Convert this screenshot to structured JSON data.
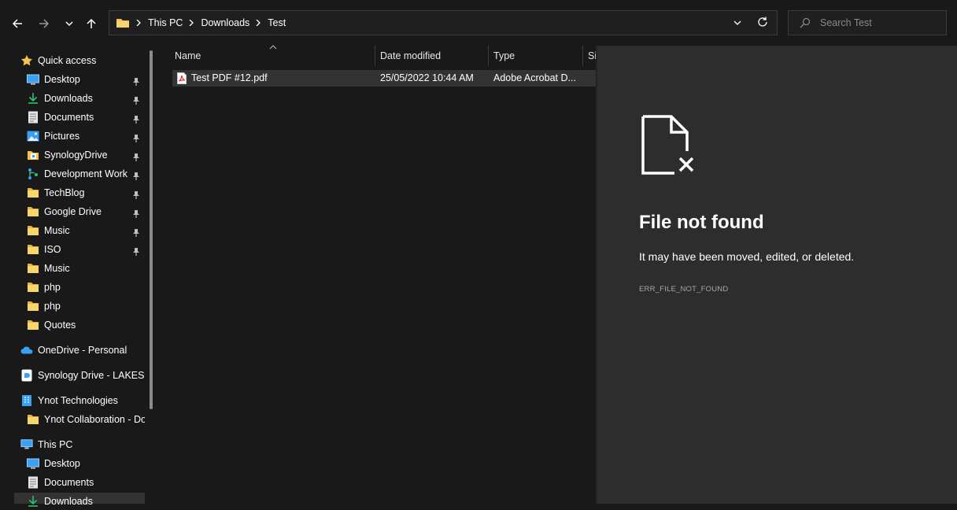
{
  "toolbar": {
    "breadcrumbs": [
      "This PC",
      "Downloads",
      "Test"
    ],
    "search_placeholder": "Search Test"
  },
  "sidebar": {
    "quick_access": "Quick access",
    "items": [
      {
        "label": "Desktop",
        "icon": "desktop-icon",
        "pinned": true
      },
      {
        "label": "Downloads",
        "icon": "download-icon",
        "pinned": true
      },
      {
        "label": "Documents",
        "icon": "documents-icon",
        "pinned": true
      },
      {
        "label": "Pictures",
        "icon": "pictures-icon",
        "pinned": true
      },
      {
        "label": "SynologyDrive",
        "icon": "synology-folder-icon",
        "pinned": true
      },
      {
        "label": "Development Work",
        "icon": "dev-folder-icon",
        "pinned": true
      },
      {
        "label": "TechBlog",
        "icon": "folder-icon",
        "pinned": true
      },
      {
        "label": "Google Drive",
        "icon": "folder-icon",
        "pinned": true
      },
      {
        "label": "Music",
        "icon": "folder-icon",
        "pinned": true
      },
      {
        "label": "ISO",
        "icon": "folder-icon",
        "pinned": true
      },
      {
        "label": "Music",
        "icon": "folder-icon",
        "pinned": false
      },
      {
        "label": "php",
        "icon": "folder-icon",
        "pinned": false
      },
      {
        "label": "php",
        "icon": "folder-icon",
        "pinned": false
      },
      {
        "label": "Quotes",
        "icon": "folder-icon",
        "pinned": false
      }
    ],
    "onedrive": "OneDrive - Personal",
    "synology_drive": "Synology Drive - LAKESIDE",
    "ynot": "Ynot Technologies",
    "ynot_collab": "Ynot Collaboration - Documents",
    "this_pc": "This PC",
    "pc_items": [
      "Desktop",
      "Documents",
      "Downloads"
    ]
  },
  "columns": {
    "name": "Name",
    "date_modified": "Date modified",
    "type": "Type",
    "size": "Size"
  },
  "files": [
    {
      "name": "Test PDF #12.pdf",
      "date_modified": "25/05/2022 10:44 AM",
      "type": "Adobe Acrobat D..."
    }
  ],
  "preview": {
    "title": "File not found",
    "message": "It may have been moved, edited, or deleted.",
    "code": "ERR_FILE_NOT_FOUND"
  },
  "colors": {
    "background": "#191919",
    "preview_background": "#2d2d2d",
    "selected_row": "#333333",
    "folder": "#f4c34a",
    "accent_blue": "#3aa0f3"
  }
}
